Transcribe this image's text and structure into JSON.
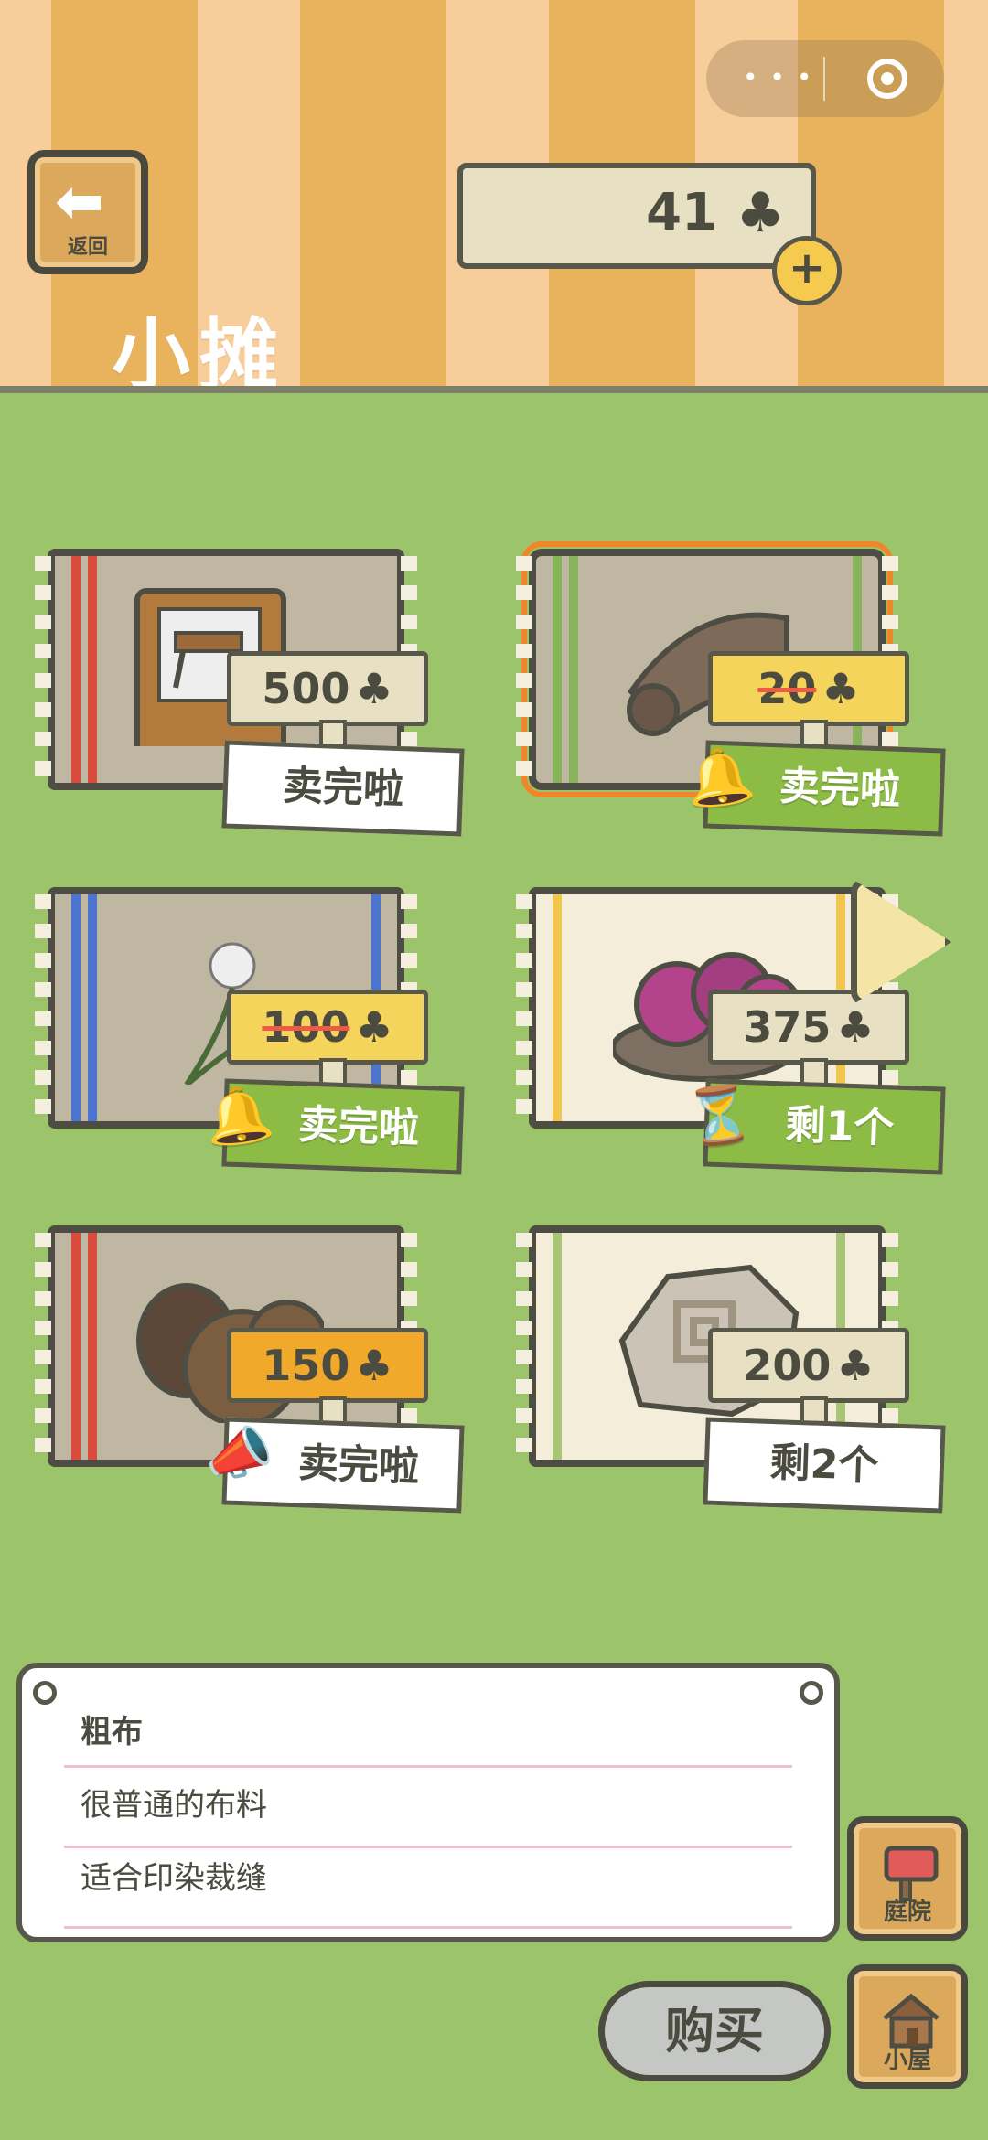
{
  "header": {
    "title": "小摊",
    "back_label": "返回"
  },
  "currency": {
    "amount": "41",
    "icon": "clover-icon"
  },
  "items": [
    {
      "price": "500",
      "status": "卖完啦"
    },
    {
      "price": "20",
      "status": "卖完啦",
      "price_struck": true
    },
    {
      "price": "100",
      "status": "卖完啦",
      "price_struck": true
    },
    {
      "price": "375",
      "status": "剩1个"
    },
    {
      "price": "150",
      "status": "卖完啦"
    },
    {
      "price": "200",
      "status": "剩2个"
    }
  ],
  "description": {
    "name": "粗布",
    "line1": "很普通的布料",
    "line2": "适合印染裁缝"
  },
  "buttons": {
    "buy": "购买",
    "yard": "庭院",
    "house": "小屋"
  },
  "colors": {
    "grass": "#9cc46a",
    "tag_green": "#8cbc45",
    "price_yellow": "#f5d45c",
    "price_orange": "#f1a92c",
    "strike_red": "#ef5a45"
  }
}
